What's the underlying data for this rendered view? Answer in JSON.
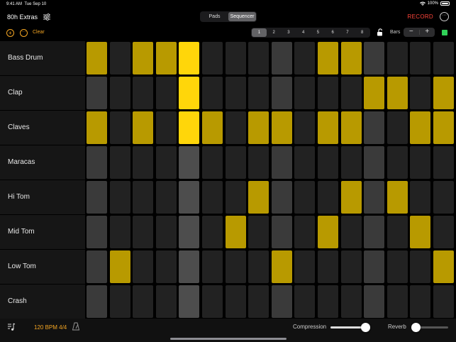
{
  "status": {
    "time": "9:41 AM",
    "date": "Tue Sep 10",
    "battery": "100%"
  },
  "header": {
    "title": "80h Extras",
    "mode_tabs": [
      {
        "label": "Pads",
        "active": false
      },
      {
        "label": "Sequencer",
        "active": true
      }
    ],
    "record_label": "RECORD",
    "record_color": "#ff453a"
  },
  "toolbar": {
    "clear_label": "Clear",
    "bars": [
      "1",
      "2",
      "3",
      "4",
      "5",
      "6",
      "7",
      "8"
    ],
    "active_bar": 1,
    "bars_label": "Bars",
    "stepper_minus": "−",
    "stepper_plus": "+",
    "accent_color": "#f5a623",
    "indicator_color": "#30d158"
  },
  "sequencer": {
    "columns": 16,
    "playhead_column": 5,
    "dim_columns": [
      1,
      9,
      13
    ],
    "on_color": "#b89a00",
    "playhead_on_color": "#ffd60a",
    "rows": [
      {
        "name": "Bass Drum",
        "steps": [
          1,
          0,
          1,
          1,
          1,
          0,
          0,
          0,
          0,
          0,
          1,
          1,
          0,
          0,
          0,
          0
        ]
      },
      {
        "name": "Clap",
        "steps": [
          0,
          0,
          0,
          0,
          1,
          0,
          0,
          0,
          0,
          0,
          0,
          0,
          1,
          1,
          0,
          1
        ]
      },
      {
        "name": "Claves",
        "steps": [
          1,
          0,
          1,
          0,
          1,
          1,
          0,
          1,
          1,
          0,
          1,
          1,
          0,
          0,
          1,
          1
        ]
      },
      {
        "name": "Maracas",
        "steps": [
          0,
          0,
          0,
          0,
          0,
          0,
          0,
          0,
          0,
          0,
          0,
          0,
          0,
          0,
          0,
          0
        ]
      },
      {
        "name": "Hi Tom",
        "steps": [
          0,
          0,
          0,
          0,
          0,
          0,
          0,
          1,
          0,
          0,
          0,
          1,
          0,
          1,
          0,
          0
        ]
      },
      {
        "name": "Mid Tom",
        "steps": [
          0,
          0,
          0,
          0,
          0,
          0,
          1,
          0,
          0,
          0,
          1,
          0,
          0,
          0,
          1,
          0
        ]
      },
      {
        "name": "Low Tom",
        "steps": [
          0,
          1,
          0,
          0,
          0,
          0,
          0,
          0,
          1,
          0,
          0,
          0,
          0,
          0,
          0,
          1
        ]
      },
      {
        "name": "Crash",
        "steps": [
          0,
          0,
          0,
          0,
          0,
          0,
          0,
          0,
          0,
          0,
          0,
          0,
          0,
          0,
          0,
          0
        ]
      }
    ]
  },
  "footer": {
    "tempo": "120 BPM 4/4",
    "compression_label": "Compression",
    "compression_value": 0.95,
    "reverb_label": "Reverb",
    "reverb_value": 0.05
  }
}
